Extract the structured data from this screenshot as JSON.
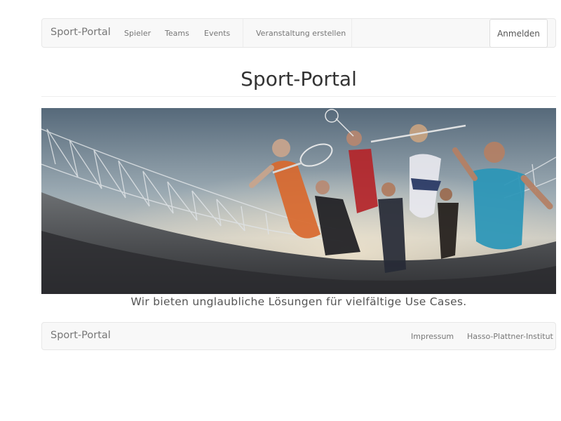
{
  "navbar": {
    "brand": "Sport-Portal",
    "links": [
      "Spieler",
      "Teams",
      "Events",
      "Veranstaltung erstellen"
    ],
    "login_label": "Anmelden"
  },
  "main": {
    "title": "Sport-Portal",
    "tagline": "Wir bieten unglaubliche Lösungen für vielfältige Use Cases."
  },
  "footer": {
    "brand": "Sport-Portal",
    "links": [
      "Impressum",
      "Hasso-Plattner-Institut"
    ]
  },
  "colors": {
    "navbar_bg": "#f8f8f8",
    "nav_text": "#777777",
    "title_text": "#333333"
  }
}
